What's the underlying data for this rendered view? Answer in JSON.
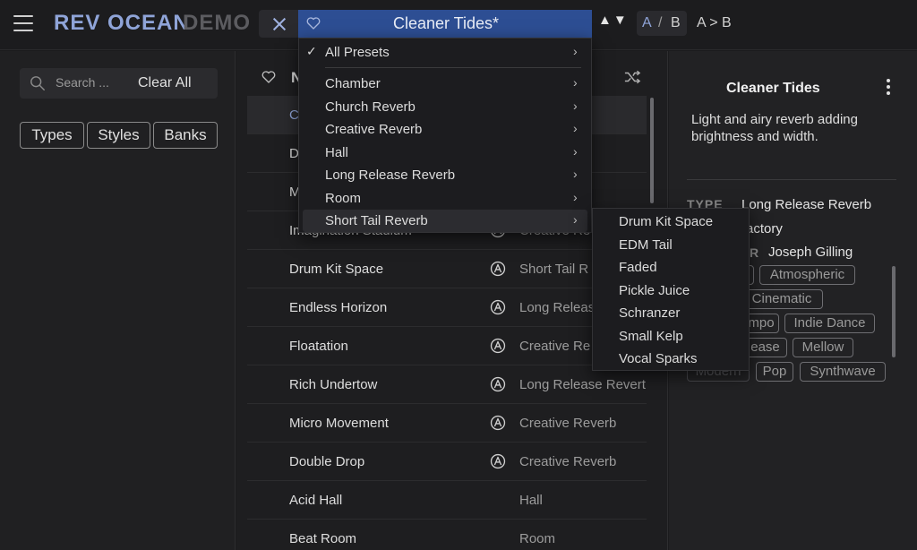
{
  "app": {
    "brand": "REV OCEAN",
    "demo": "DEMO"
  },
  "preset_bar": {
    "name": "Cleaner Tides*",
    "arrows": "▲▼"
  },
  "ab": {
    "a": "A",
    "sep": "/",
    "b": "B",
    "copy": "A > B"
  },
  "search": {
    "placeholder": "Search ...",
    "clear_label": "Clear All"
  },
  "filters": [
    "Types",
    "Styles",
    "Banks"
  ],
  "list": {
    "header_name": "N",
    "rows": [
      {
        "name": "C",
        "type": "se Reverb",
        "selected": true,
        "factory": false
      },
      {
        "name": "D",
        "type": "se Reverb",
        "factory": false
      },
      {
        "name": "M",
        "type": "verb",
        "factory": false
      },
      {
        "name": "Imagination Stadium",
        "type": "Creative Re",
        "factory": true
      },
      {
        "name": "Drum Kit Space",
        "type": "Short Tail R",
        "factory": true
      },
      {
        "name": "Endless Horizon",
        "type": "Long Releas",
        "factory": true
      },
      {
        "name": "Floatation",
        "type": "Creative Re",
        "factory": true
      },
      {
        "name": "Rich Undertow",
        "type": "Long Release Revert",
        "factory": true
      },
      {
        "name": "Micro Movement",
        "type": "Creative Reverb",
        "factory": true
      },
      {
        "name": "Double Drop",
        "type": "Creative Reverb",
        "factory": true
      },
      {
        "name": "Acid Hall",
        "type": "Hall",
        "factory": false
      },
      {
        "name": "Beat Room",
        "type": "Room",
        "factory": false
      }
    ]
  },
  "details": {
    "title": "Cleaner Tides",
    "description": "Light and airy reverb adding brightness and width.",
    "type_label": "TYPE",
    "type_value": "Long Release Reverb",
    "bank_value": "actory",
    "designer_label": "R",
    "designer_value": "Joseph Gilling",
    "tags": [
      "Atmospheric",
      "Cinematic",
      "mpo",
      "Indie Dance",
      "ease",
      "Mellow",
      "Modern",
      "Pop",
      "Synthwave"
    ]
  },
  "menu": {
    "items": [
      {
        "label": "All Presets",
        "checked": true
      },
      {
        "label": "Chamber"
      },
      {
        "label": "Church Reverb"
      },
      {
        "label": "Creative Reverb"
      },
      {
        "label": "Hall"
      },
      {
        "label": "Long Release Reverb"
      },
      {
        "label": "Room"
      },
      {
        "label": "Short Tail Reverb",
        "active": true
      }
    ],
    "check_glyph": "✓",
    "chevron_glyph": "›"
  },
  "submenu": {
    "items": [
      "Drum Kit Space",
      "EDM Tail",
      "Faded",
      "Pickle Juice",
      "Schranzer",
      "Small Kelp",
      "Vocal Sparks"
    ]
  },
  "icons": {
    "heart": "heart-icon",
    "search": "search-icon",
    "shuffle": "shuffle-icon",
    "factory": "arturia-a-icon",
    "kebab": "kebab-menu-icon",
    "close": "close-icon",
    "menu": "hamburger-icon"
  },
  "colors": {
    "accent": "#8fa4d8",
    "preset_bar": "#2d4e93",
    "background": "#1b1b1d"
  }
}
